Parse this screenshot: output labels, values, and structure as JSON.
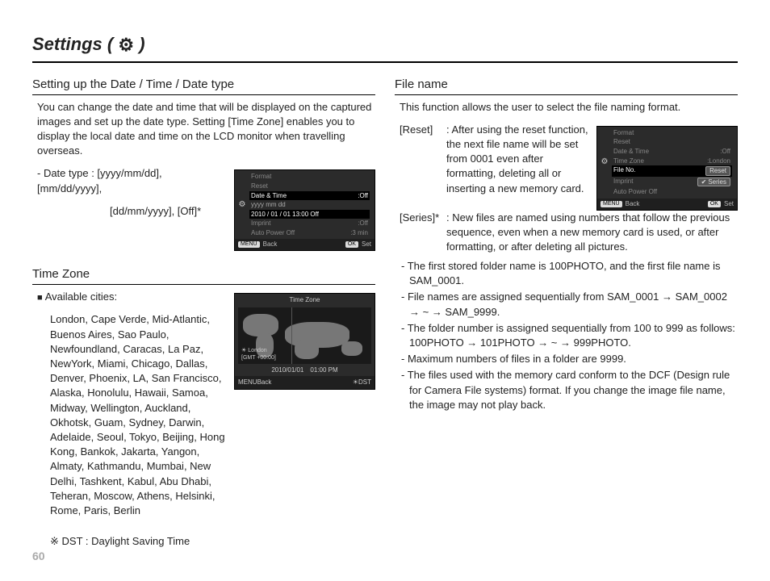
{
  "page_number": "60",
  "title_prefix": "Settings ( ",
  "title_suffix": " )",
  "left": {
    "sec1_heading": "Setting up the Date / Time / Date type",
    "sec1_para": "You can change the date and time that will be displayed on the captured images and set up the date type. Setting [Time Zone] enables you to display the local date and time on the LCD monitor when travelling overseas.",
    "date_type_line1": "- Date type : [yyyy/mm/dd], [mm/dd/yyyy],",
    "date_type_line2": "[dd/mm/yyyy], [Off]*",
    "sec2_heading": "Time Zone",
    "cities_label": "Available cities:",
    "cities": "London, Cape Verde, Mid-Atlantic, Buenos Aires, Sao Paulo, Newfoundland, Caracas, La Paz, NewYork, Miami, Chicago, Dallas, Denver, Phoenix, LA, San Francisco, Alaska, Honolulu, Hawaii, Samoa, Midway, Wellington, Auckland, Okhotsk, Guam, Sydney, Darwin, Adelaide, Seoul, Tokyo, Beijing, Hong Kong, Bankok, Jakarta, Yangon, Almaty, Kathmandu, Mumbai, New Delhi, Tashkent, Kabul, Abu Dhabi, Teheran, Moscow, Athens, Helsinki, Rome, Paris, Berlin",
    "dst_note": "DST : Daylight Saving Time"
  },
  "right": {
    "sec_heading": "File name",
    "para": "This function allows the user to select the file naming format.",
    "reset_tag": "[Reset]",
    "reset_colon": ": ",
    "reset_desc": "After using the reset function, the next file name will be set from 0001 even after formatting, deleting all or inserting a new memory card.",
    "series_tag": "[Series]*",
    "series_colon": " : ",
    "series_desc": "New files are named using numbers that follow the previous sequence, even when a new memory card is used, or after formatting, or after deleting all pictures.",
    "bullets": [
      "The first stored folder name is 100PHOTO, and the first file name is SAM_0001.",
      "File names are assigned sequentially from SAM_0001 → SAM_0002 → ~ → SAM_9999.",
      "The folder number is assigned sequentially from 100 to 999 as follows: 100PHOTO → 101PHOTO → ~ → 999PHOTO.",
      "Maximum numbers of files in a folder are 9999.",
      "The files used with the memory card conform to the DCF (Design rule for Camera File systems) format. If you change the image file name, the image may not play back."
    ]
  },
  "lcd_date": {
    "items": [
      "Format",
      "Reset",
      "Date & Time",
      "Imprint",
      "Auto Power Off"
    ],
    "sel_val": ":Off",
    "val_imprint": ":Off",
    "val_apo": ":3 min",
    "date_fmt": "yyyy  mm  dd",
    "date_row": "2010 / 01 / 01    13:00    Off",
    "back": "Back",
    "set": "Set",
    "menu": "MENU",
    "ok": "OK"
  },
  "lcd_map": {
    "header": "Time Zone",
    "city": "London",
    "gmt": "[GMT +00:00]",
    "date": "2010/01/01",
    "time": "01:00 PM",
    "back": "Back",
    "dst": "DST",
    "menu": "MENU"
  },
  "lcd_file": {
    "items": [
      "Format",
      "Reset",
      "Date & Time",
      "Time Zone",
      "File No.",
      "Imprint",
      "Auto Power Off"
    ],
    "val_dt": ":Off",
    "val_tz": ":London",
    "opt_reset": "Reset",
    "opt_series": "Series",
    "back": "Back",
    "set": "Set",
    "menu": "MENU",
    "ok": "OK"
  }
}
